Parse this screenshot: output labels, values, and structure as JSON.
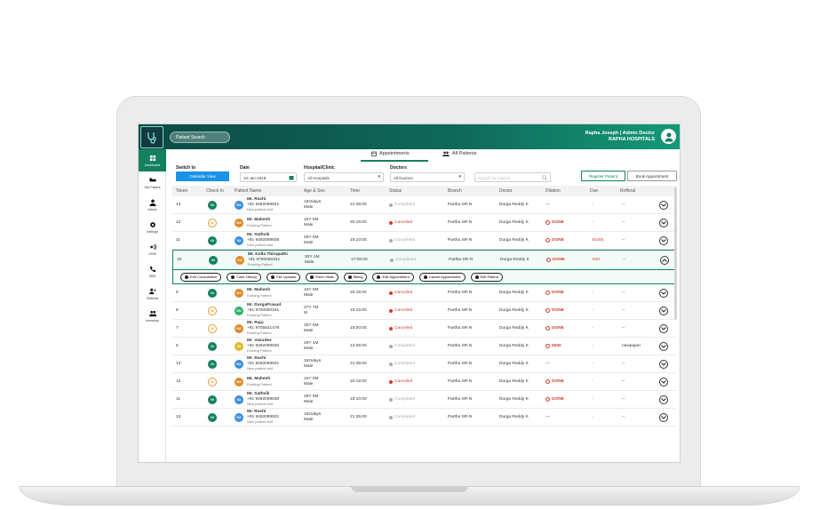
{
  "app": {
    "search_placeholder": "Patient Search",
    "user_name": "Rapha Joseph | Admin Doctor",
    "hospital": "RAPHA HOSPITALS"
  },
  "sidebar": {
    "items": [
      {
        "label": "Dashboard",
        "icon": "dashboard-icon"
      },
      {
        "label": "Out Patient",
        "icon": "bed-icon"
      },
      {
        "label": "Admin",
        "icon": "user-icon"
      },
      {
        "label": "Settings",
        "icon": "gear-icon"
      },
      {
        "label": "CRM",
        "icon": "broadcast-icon"
      },
      {
        "label": "SMS",
        "icon": "phone-icon"
      },
      {
        "label": "Referral",
        "icon": "referral-icon"
      },
      {
        "label": "Inventory",
        "icon": "people-icon"
      }
    ]
  },
  "tabs": {
    "appointments": "Appointments",
    "all_patients": "All Patients"
  },
  "filters": {
    "switch_to_label": "Switch to",
    "switch_button": "Calendar View",
    "date_label": "Date",
    "date_value": "10-Jan-2019",
    "hospital_label": "Hospital/Clinic",
    "hospital_value": "All Hospitals",
    "doctor_label": "Doctors",
    "doctor_value": "All Doctors",
    "search_placeholder": "Search for Invoice",
    "register_button": "Register Patient",
    "book_button": "Book Appointment"
  },
  "table": {
    "headers": {
      "token": "Token",
      "checkin": "Check In",
      "patient": "Patient Name",
      "agesex": "Age & Sex",
      "time": "Time",
      "status": "Status",
      "branch": "Branch",
      "doctor": "Doctor",
      "dilation": "Dilation",
      "due": "Due",
      "referral": "Refferal"
    },
    "rows": [
      {
        "token": "13",
        "checkin": "IN",
        "initials": "RA",
        "ini_color": "#3b8fe0",
        "name": "Mr. Rashi",
        "phone": "+91 9492099931",
        "sub": "New patient visit",
        "age": "15Odays",
        "sex": "Male",
        "time": "21:35:00",
        "status": "Completed",
        "status_color": "#aaaaaa",
        "branch": "Partha SR-N",
        "doctor": "Durga Reddy K",
        "dilation": "---",
        "dil_color": "#d63b2c",
        "due": "-",
        "referral": "--"
      },
      {
        "token": "12",
        "checkin": "IN",
        "initials": "MA",
        "ini_color": "#e08a2b",
        "name": "Mr. Mahesh",
        "phone": "",
        "sub": "Existing Patient",
        "age": "15Y 0M",
        "sex": "Male",
        "time": "20:15:00",
        "status": "Canceled",
        "status_color": "#d63b2c",
        "branch": "Partha SR-N",
        "doctor": "Durga Reddy K",
        "dilation": "DONE",
        "dil_color": "#d63b2c",
        "due": "-",
        "referral": "--"
      },
      {
        "token": "11",
        "checkin": "IN",
        "initials": "SA",
        "ini_color": "#3b8fe0",
        "name": "Mr. Sathvik",
        "phone": "+91 9492099938",
        "sub": "New patient visit",
        "age": "29Y 0M",
        "sex": "Male",
        "time": "19:10:00",
        "status": "Completed",
        "status_color": "#aaaaaa",
        "branch": "Partha SR-N",
        "doctor": "Durga Reddy K",
        "dilation": "DONE",
        "dil_color": "#d63b2c",
        "due": "40400",
        "referral": "--"
      },
      {
        "token": "10",
        "checkin": "IN",
        "initials": "KO",
        "ini_color": "#e08a2b",
        "name": "Mr. Kolla Thirupathi",
        "phone": "+91 9700056151",
        "sub": "Existing Patient",
        "age": "30Y 1M",
        "sex": "Male",
        "time": "17:00:00",
        "status": "Completed",
        "status_color": "#aaaaaa",
        "branch": "Partha SR-N",
        "doctor": "Durga Reddy K",
        "dilation": "DONE",
        "dil_color": "#d63b2c",
        "due": "540",
        "referral": "--"
      },
      {
        "token": "9",
        "checkin": "IN",
        "initials": "MA",
        "ini_color": "#e08a2b",
        "name": "Mr. Mahesh",
        "phone": "",
        "sub": "Existing Patient",
        "age": "15Y 0M",
        "sex": "Male",
        "time": "20:15:00",
        "status": "Canceled",
        "status_color": "#d63b2c",
        "branch": "Partha SR-N",
        "doctor": "Durga Reddy K",
        "dilation": "DONE",
        "dil_color": "#d63b2c",
        "due": "-",
        "referral": "--"
      },
      {
        "token": "8",
        "checkin": "IN",
        "initials": "DU",
        "ini_color": "#2fb36a",
        "name": "Mr. DurgaPrasad",
        "phone": "+91 9700050151",
        "sub": "Existing Patient",
        "age": "27Y 7M",
        "sex": "M",
        "time": "15:15:00",
        "status": "Canceled",
        "status_color": "#d63b2c",
        "branch": "Partha SR-N",
        "doctor": "Durga Reddy K",
        "dilation": "DONE",
        "dil_color": "#d63b2c",
        "due": "-",
        "referral": "--"
      },
      {
        "token": "7",
        "checkin": "IN",
        "initials": "RA",
        "ini_color": "#e08a2b",
        "name": "Mr. Raju",
        "phone": "+91 9705621478",
        "sub": "Existing Patient",
        "age": "25Y 0M",
        "sex": "Male",
        "time": "15:00:00",
        "status": "Canceled",
        "status_color": "#d63b2c",
        "branch": "Partha SR-N",
        "doctor": "Durga Reddy K",
        "dilation": "DONE",
        "dil_color": "#d63b2c",
        "due": "-",
        "referral": "--"
      },
      {
        "token": "5",
        "checkin": "IN",
        "initials": "VA",
        "ini_color": "#e0b92b",
        "name": "Mr. Vasudev",
        "phone": "+91 9492099930",
        "sub": "Existing Patient",
        "age": "29Y 1M",
        "sex": "Male",
        "time": "12:05:00",
        "status": "Completed",
        "status_color": "#aaaaaa",
        "branch": "Partha SR-N",
        "doctor": "Durga Reddy K",
        "dilation": "5500",
        "dil_color": "#d63b2c",
        "due": "-",
        "referral": "newpaper"
      },
      {
        "token": "13",
        "checkin": "IN",
        "initials": "RA",
        "ini_color": "#3b8fe0",
        "name": "Mr. Rashi",
        "phone": "+91 9492099931",
        "sub": "New patient visit",
        "age": "15Odays",
        "sex": "Male",
        "time": "21:35:00",
        "status": "Completed",
        "status_color": "#aaaaaa",
        "branch": "Partha SR-N",
        "doctor": "Durga Reddy K",
        "dilation": "---",
        "dil_color": "#d63b2c",
        "due": "-",
        "referral": "--"
      },
      {
        "token": "12",
        "checkin": "IN",
        "initials": "MA",
        "ini_color": "#e08a2b",
        "name": "Mr. Mahesh",
        "phone": "",
        "sub": "Existing Patient",
        "age": "15Y 0M",
        "sex": "Male",
        "time": "20:15:00",
        "status": "Canceled",
        "status_color": "#d63b2c",
        "branch": "Partha SR-N",
        "doctor": "Durga Reddy K",
        "dilation": "DONE",
        "dil_color": "#d63b2c",
        "due": "-",
        "referral": "--"
      },
      {
        "token": "11",
        "checkin": "IN",
        "initials": "SA",
        "ini_color": "#3b8fe0",
        "name": "Mr. Sathvik",
        "phone": "+91 9492099938",
        "sub": "New patient visit",
        "age": "29Y 0M",
        "sex": "Male",
        "time": "19:10:00",
        "status": "Completed",
        "status_color": "#aaaaaa",
        "branch": "Partha SR-N",
        "doctor": "Durga Reddy K",
        "dilation": "DONE",
        "dil_color": "#d63b2c",
        "due": "-",
        "referral": "--"
      },
      {
        "token": "13",
        "checkin": "IN",
        "initials": "RA",
        "ini_color": "#3b8fe0",
        "name": "Mr. Rashi",
        "phone": "+91 9492099931",
        "sub": "New patient visit",
        "age": "15Odays",
        "sex": "Male",
        "time": "21:35:00",
        "status": "Completed",
        "status_color": "#aaaaaa",
        "branch": "Partha SR-N",
        "doctor": "Durga Reddy K",
        "dilation": "---",
        "dil_color": "#d63b2c",
        "due": "-",
        "referral": "--"
      }
    ],
    "expanded_row_index": 3,
    "checkin_variants": [
      "in",
      "ip",
      "in",
      "in",
      "in",
      "ip",
      "ip",
      "in",
      "in",
      "ip",
      "in",
      "in"
    ],
    "actions": [
      "Edit Consultation",
      "Case History",
      "File Uploads",
      "Enter Vitals",
      "Billing",
      "Edit Appointment",
      "Cancel Appointment",
      "Edit Patient"
    ]
  }
}
